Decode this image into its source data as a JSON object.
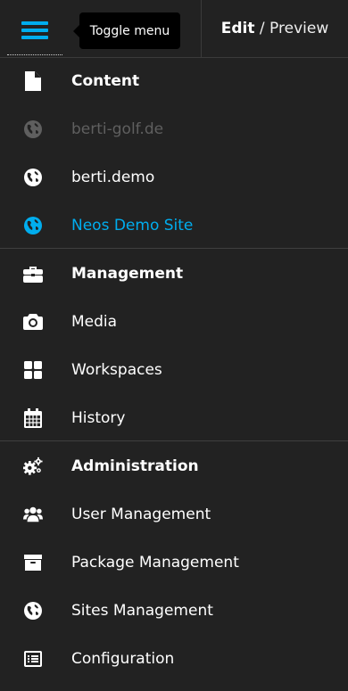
{
  "header": {
    "toggle_tooltip": "Toggle menu",
    "edit_label": "Edit",
    "separator": " / ",
    "preview_label": "Preview"
  },
  "menu": {
    "content": {
      "heading": "Content",
      "sites": [
        {
          "label": "berti-golf.de",
          "state": "disabled"
        },
        {
          "label": "berti.demo",
          "state": "normal"
        },
        {
          "label": "Neos Demo Site",
          "state": "active"
        }
      ]
    },
    "management": {
      "heading": "Management",
      "items": [
        {
          "label": "Media",
          "icon": "camera-icon"
        },
        {
          "label": "Workspaces",
          "icon": "th-large-icon"
        },
        {
          "label": "History",
          "icon": "calendar-icon"
        }
      ]
    },
    "administration": {
      "heading": "Administration",
      "items": [
        {
          "label": "User Management",
          "icon": "users-icon"
        },
        {
          "label": "Package Management",
          "icon": "archive-icon"
        },
        {
          "label": "Sites Management",
          "icon": "globe-icon"
        },
        {
          "label": "Configuration",
          "icon": "list-alt-icon"
        }
      ]
    }
  },
  "colors": {
    "background": "#222222",
    "accent": "#00adee",
    "disabled": "#5f5f5f",
    "text": "#ffffff"
  }
}
